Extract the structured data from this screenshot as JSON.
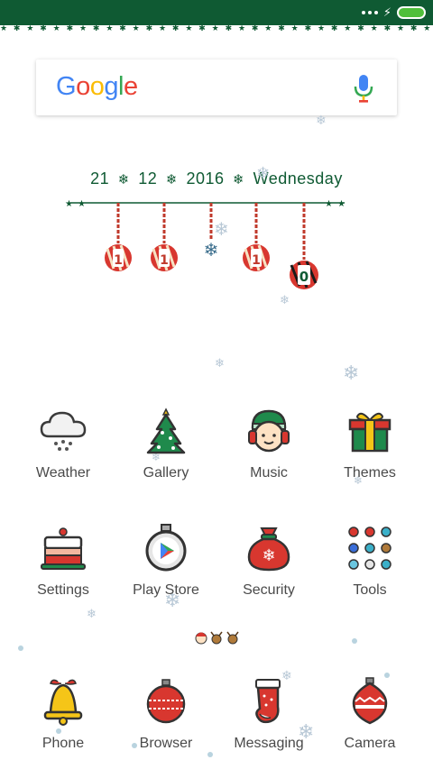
{
  "status_bar": {
    "star_border": "★ ✱ ★ ✱ ★ ✱ ★ ✱ ★ ✱ ★ ✱ ★ ✱ ★ ✱ ★ ✱ ★ ✱ ★ ✱ ★ ✱ ★ ✱ ★ ✱ ★ ✱ ★ ✱ ★ ✱ ★ ✱ ★ ✱ ★ ✱ ★ ✱ ★ ✱ ★ ✱ ★",
    "bg_color": "#0f5a33",
    "battery_color": "#4fbf3a"
  },
  "search": {
    "logo": [
      "G",
      "o",
      "o",
      "g",
      "l",
      "e"
    ],
    "logo_colors": [
      "#4285F4",
      "#EA4335",
      "#FBBC05",
      "#4285F4",
      "#34A853",
      "#EA4335"
    ]
  },
  "date": {
    "day": "21",
    "month": "12",
    "year": "2016",
    "weekday": "Wednesday",
    "separator": "❄"
  },
  "clock": {
    "ornaments": [
      "1",
      "1",
      "❄",
      "1",
      "0"
    ]
  },
  "apps": [
    {
      "label": "Weather",
      "icon": "weather-cloud-icon"
    },
    {
      "label": "Gallery",
      "icon": "christmas-tree-icon"
    },
    {
      "label": "Music",
      "icon": "elf-headphones-icon"
    },
    {
      "label": "Themes",
      "icon": "gift-box-icon"
    },
    {
      "label": "Settings",
      "icon": "cake-icon"
    },
    {
      "label": "Play Store",
      "icon": "play-store-ornament-icon"
    },
    {
      "label": "Security",
      "icon": "santa-sack-icon"
    },
    {
      "label": "Tools",
      "icon": "tools-folder-icon"
    }
  ],
  "dock": [
    {
      "label": "Phone",
      "icon": "bell-icon"
    },
    {
      "label": "Browser",
      "icon": "ornament-ball-icon"
    },
    {
      "label": "Messaging",
      "icon": "stocking-icon"
    },
    {
      "label": "Camera",
      "icon": "ornament-drop-icon"
    }
  ],
  "theme_colors": {
    "green": "#0f5a33",
    "red": "#d8372f",
    "gold": "#f5c518"
  }
}
